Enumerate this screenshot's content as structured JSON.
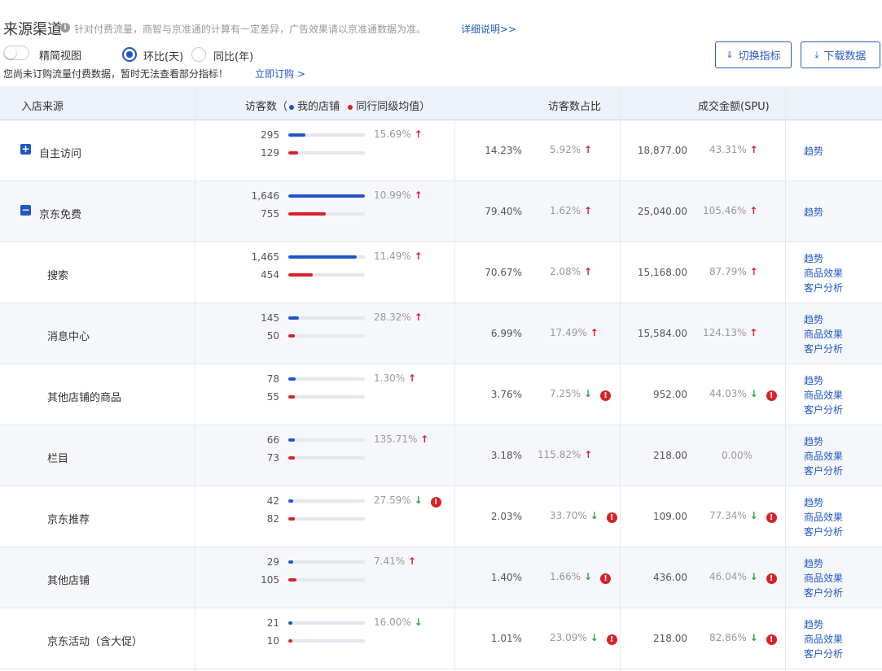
{
  "header": {
    "title": "来源渠道",
    "subtitle": "针对付费流量，商智与京准通的计算有一定差异，广告效果请以京准通数据为准。",
    "detail_link": "详细说明>>",
    "toggle_label": "精简视图",
    "radio_day": "环比(天)",
    "radio_year": "同比(年)",
    "btn_switch": "切换指标",
    "btn_download": "下载数据",
    "notice": "您尚未订购流量付费数据，暂时无法查看部分指标！",
    "order_link": "立即订购 >"
  },
  "table": {
    "col_source": "入店来源",
    "col_visitors": "访客数（",
    "legend_mine": "我的店铺",
    "legend_peer": "同行同级均值）",
    "col_share": "访客数占比",
    "col_amount": "成交金额(SPU)",
    "link_trend": "趋势",
    "link_effect": "商品效果",
    "link_customer": "客户分析",
    "rows": [
      {
        "name": "自主访问",
        "level": 0,
        "expand": "+",
        "mine": "295",
        "peer": "129",
        "mine_frac": 0.22,
        "peer_frac": 0.13,
        "v_pct": "15.69%",
        "v_dir": "up",
        "v_warn": false,
        "share": "14.23%",
        "s_pct": "5.92%",
        "s_dir": "up",
        "s_warn": false,
        "amount": "18,877.00",
        "a_pct": "43.31%",
        "a_dir": "up",
        "a_warn": false,
        "links": 1
      },
      {
        "name": "京东免费",
        "level": 0,
        "expand": "−",
        "mine": "1,646",
        "peer": "755",
        "mine_frac": 1.0,
        "peer_frac": 0.49,
        "v_pct": "10.99%",
        "v_dir": "up",
        "v_warn": false,
        "share": "79.40%",
        "s_pct": "1.62%",
        "s_dir": "up",
        "s_warn": false,
        "amount": "25,040.00",
        "a_pct": "105.46%",
        "a_dir": "up",
        "a_warn": false,
        "links": 1
      },
      {
        "name": "搜索",
        "level": 1,
        "mine": "1,465",
        "peer": "454",
        "mine_frac": 0.89,
        "peer_frac": 0.32,
        "v_pct": "11.49%",
        "v_dir": "up",
        "v_warn": false,
        "share": "70.67%",
        "s_pct": "2.08%",
        "s_dir": "up",
        "s_warn": false,
        "amount": "15,168.00",
        "a_pct": "87.79%",
        "a_dir": "up",
        "a_warn": false,
        "links": 3
      },
      {
        "name": "消息中心",
        "level": 1,
        "mine": "145",
        "peer": "50",
        "mine_frac": 0.14,
        "peer_frac": 0.09,
        "v_pct": "28.32%",
        "v_dir": "up",
        "v_warn": false,
        "share": "6.99%",
        "s_pct": "17.49%",
        "s_dir": "up",
        "s_warn": false,
        "amount": "15,584.00",
        "a_pct": "124.13%",
        "a_dir": "up",
        "a_warn": false,
        "links": 3
      },
      {
        "name": "其他店铺的商品",
        "level": 1,
        "mine": "78",
        "peer": "55",
        "mine_frac": 0.1,
        "peer_frac": 0.09,
        "v_pct": "1.30%",
        "v_dir": "up",
        "v_warn": false,
        "share": "3.76%",
        "s_pct": "7.25%",
        "s_dir": "down",
        "s_warn": true,
        "amount": "952.00",
        "a_pct": "44.03%",
        "a_dir": "down",
        "a_warn": true,
        "links": 3
      },
      {
        "name": "栏目",
        "level": 1,
        "mine": "66",
        "peer": "73",
        "mine_frac": 0.09,
        "peer_frac": 0.09,
        "v_pct": "135.71%",
        "v_dir": "up",
        "v_warn": false,
        "share": "3.18%",
        "s_pct": "115.82%",
        "s_dir": "up",
        "s_warn": false,
        "amount": "218.00",
        "a_pct": "0.00%",
        "a_dir": "",
        "a_warn": false,
        "links": 3
      },
      {
        "name": "京东推荐",
        "level": 1,
        "mine": "42",
        "peer": "82",
        "mine_frac": 0.06,
        "peer_frac": 0.09,
        "v_pct": "27.59%",
        "v_dir": "down",
        "v_warn": true,
        "share": "2.03%",
        "s_pct": "33.70%",
        "s_dir": "down",
        "s_warn": true,
        "amount": "109.00",
        "a_pct": "77.34%",
        "a_dir": "down",
        "a_warn": true,
        "links": 3
      },
      {
        "name": "其他店铺",
        "level": 1,
        "mine": "29",
        "peer": "105",
        "mine_frac": 0.06,
        "peer_frac": 0.11,
        "v_pct": "7.41%",
        "v_dir": "up",
        "v_warn": false,
        "share": "1.40%",
        "s_pct": "1.66%",
        "s_dir": "down",
        "s_warn": true,
        "amount": "436.00",
        "a_pct": "46.04%",
        "a_dir": "down",
        "a_warn": true,
        "links": 3
      },
      {
        "name": "京东活动（含大促）",
        "level": 1,
        "mine": "21",
        "peer": "10",
        "mine_frac": 0.05,
        "peer_frac": 0.05,
        "v_pct": "16.00%",
        "v_dir": "down",
        "v_warn": false,
        "share": "1.01%",
        "s_pct": "23.09%",
        "s_dir": "down",
        "s_warn": true,
        "amount": "218.00",
        "a_pct": "82.86%",
        "a_dir": "down",
        "a_warn": true,
        "links": 3
      }
    ]
  }
}
